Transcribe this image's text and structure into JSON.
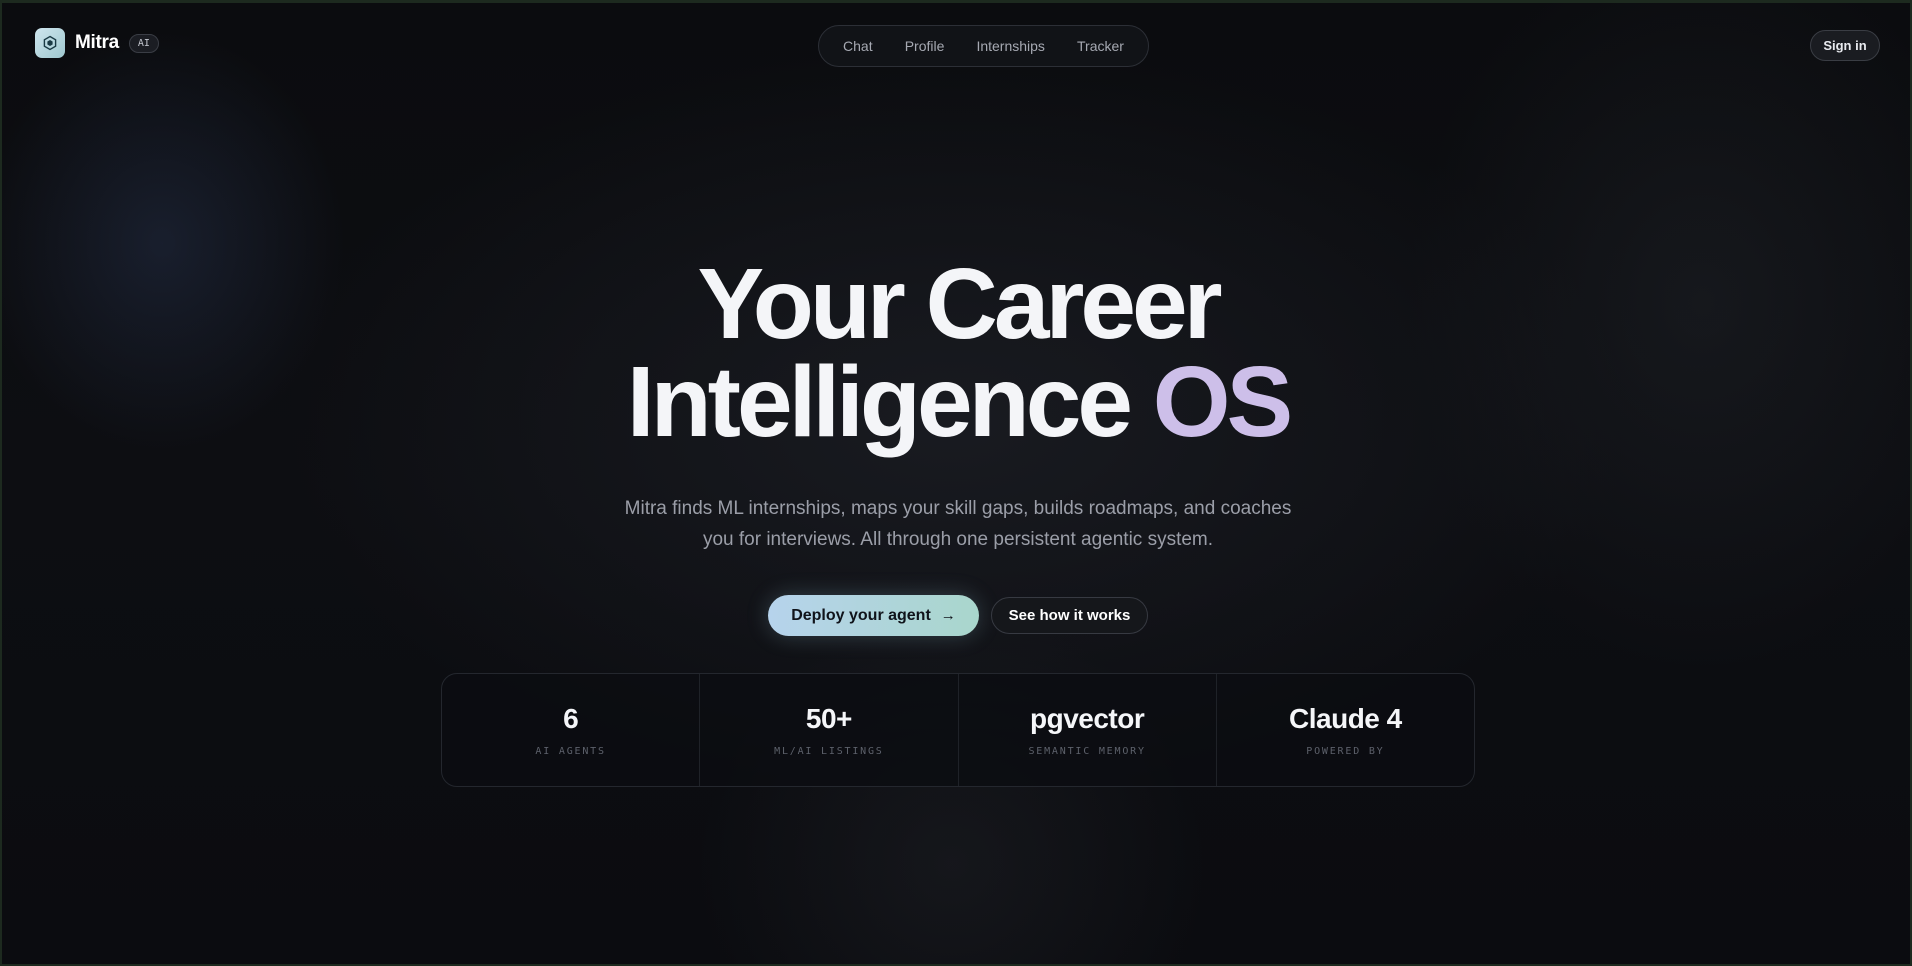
{
  "header": {
    "brand_name": "Mitra",
    "brand_badge": "AI",
    "logo_icon": "hexagon-icon",
    "nav": [
      "Chat",
      "Profile",
      "Internships",
      "Tracker"
    ],
    "sign_in": "Sign in"
  },
  "hero": {
    "title_line1": "Your Career",
    "title_line2_main": "Intelligence",
    "title_line2_accent": "OS",
    "subtitle_line1": "Mitra finds ML internships, maps your skill gaps, builds roadmaps, and coaches",
    "subtitle_line2": "you for interviews. All through one persistent agentic system.",
    "cta_primary": "Deploy your agent",
    "cta_primary_icon": "arrow-right-icon",
    "cta_secondary": "See how it works"
  },
  "stats": [
    {
      "value": "6",
      "label": "AI AGENTS"
    },
    {
      "value": "50+",
      "label": "ML/AI LISTINGS"
    },
    {
      "value": "pgvector",
      "label": "SEMANTIC MEMORY"
    },
    {
      "value": "Claude 4",
      "label": "POWERED BY"
    }
  ],
  "colors": {
    "background": "#0c0d11",
    "accent_text": "#cdbfe9",
    "primary_button_start": "#b6d3ec",
    "primary_button_end": "#a9d6cc"
  }
}
